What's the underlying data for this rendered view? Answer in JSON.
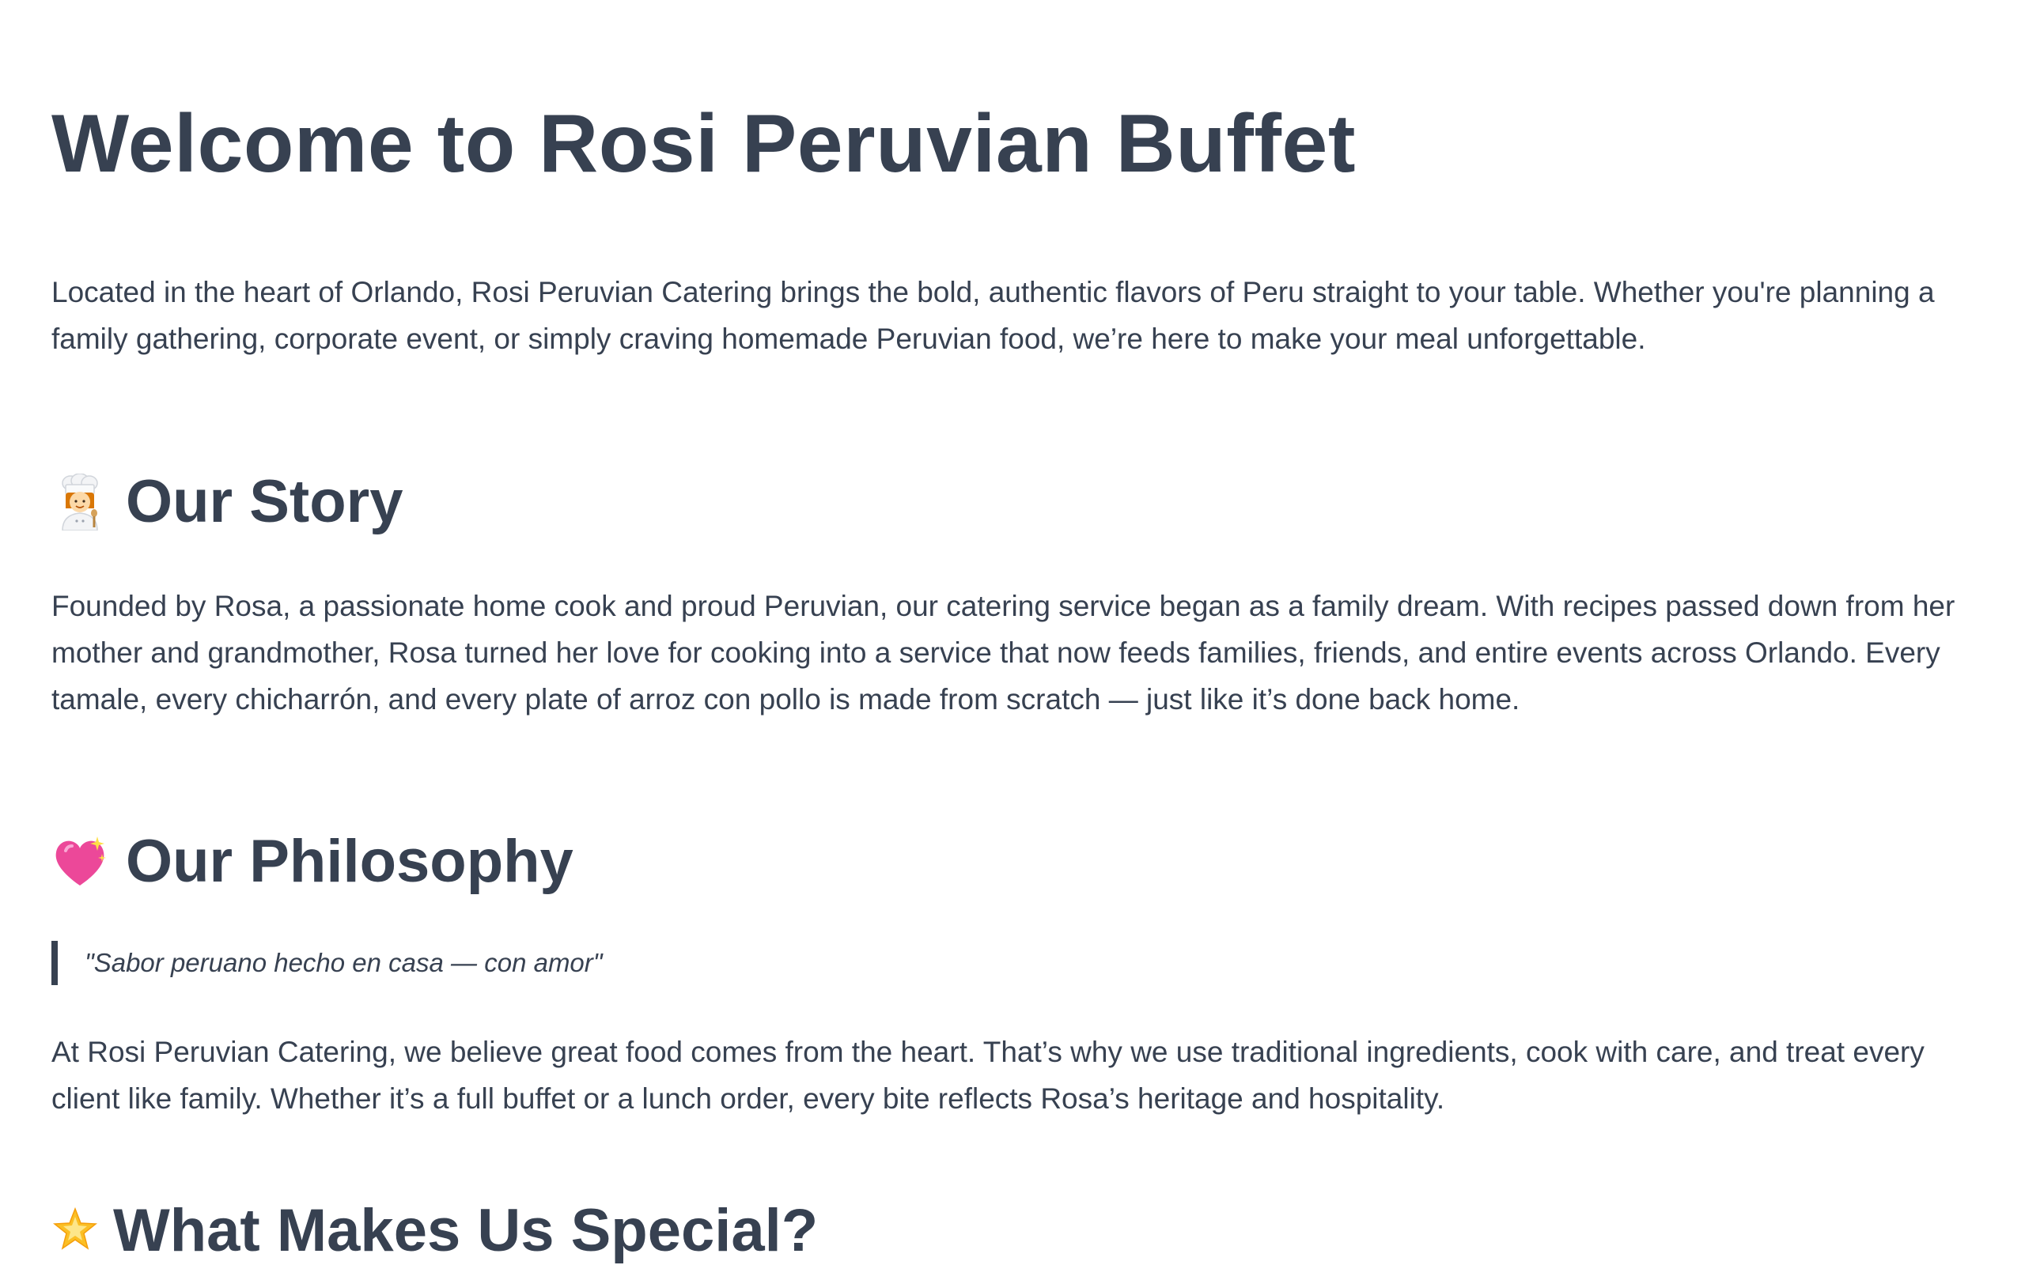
{
  "page": {
    "title": "Welcome to Rosi Peruvian Buffet",
    "intro": "Located in the heart of Orlando, Rosi Peruvian Catering brings the bold, authentic flavors of Peru straight to your table. Whether you're planning a family gathering, corporate event, or simply craving homemade Peruvian food, we’re here to make your meal unforgettable."
  },
  "sections": {
    "story": {
      "icon": "woman-cook-icon",
      "heading": "Our Story",
      "body": "Founded by Rosa, a passionate home cook and proud Peruvian, our catering service began as a family dream. With recipes passed down from her mother and grandmother, Rosa turned her love for cooking into a service that now feeds families, friends, and entire events across Orlando. Every tamale, every chicharrón, and every plate of arroz con pollo is made from scratch — just like it’s done back home."
    },
    "philosophy": {
      "icon": "sparkling-heart-icon",
      "heading": "Our Philosophy",
      "quote": "\"Sabor peruano hecho en casa — con amor\"",
      "body": "At Rosi Peruvian Catering, we believe great food comes from the heart. That’s why we use traditional ingredients, cook with care, and treat every client like family. Whether it’s a full buffet or a lunch order, every bite reflects Rosa’s heritage and hospitality."
    },
    "special": {
      "icon": "glowing-star-icon",
      "heading": "What Makes Us Special?"
    }
  },
  "colors": {
    "text": "#374151",
    "background": "#ffffff",
    "heart": "#ec4899",
    "star": "#fbbf24"
  }
}
